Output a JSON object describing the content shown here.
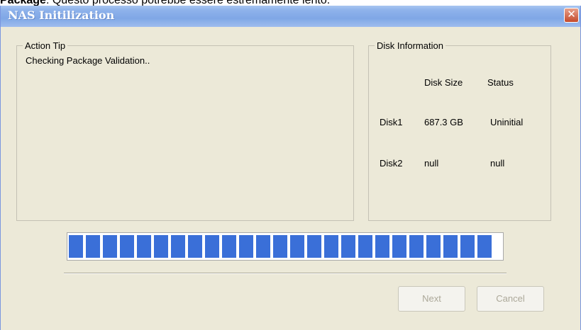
{
  "caption": {
    "bold": "Package",
    "rest": ": Questo processo potrebbe essere estremamente lento."
  },
  "window": {
    "title": "NAS Initilization",
    "close_glyph": "✕"
  },
  "action_tip": {
    "legend": "Action Tip",
    "message": "Checking Package Validation.."
  },
  "disk_info": {
    "legend": "Disk Information",
    "headers": {
      "size": "Disk Size",
      "status": "Status"
    },
    "disks": [
      {
        "name": "Disk1",
        "size": "687.3 GB",
        "status": "Uninitial"
      },
      {
        "name": "Disk2",
        "size": "null",
        "status": "null"
      }
    ]
  },
  "progress": {
    "fraction": 0.98
  },
  "buttons": {
    "next": "Next",
    "cancel": "Cancel"
  },
  "colors": {
    "progress_block": "#3a6fd8",
    "window_bg": "#ece9d8",
    "title_bar": "#8fb3eb",
    "close_button": "#c44a2c"
  },
  "icons": {
    "close": "close-icon"
  }
}
